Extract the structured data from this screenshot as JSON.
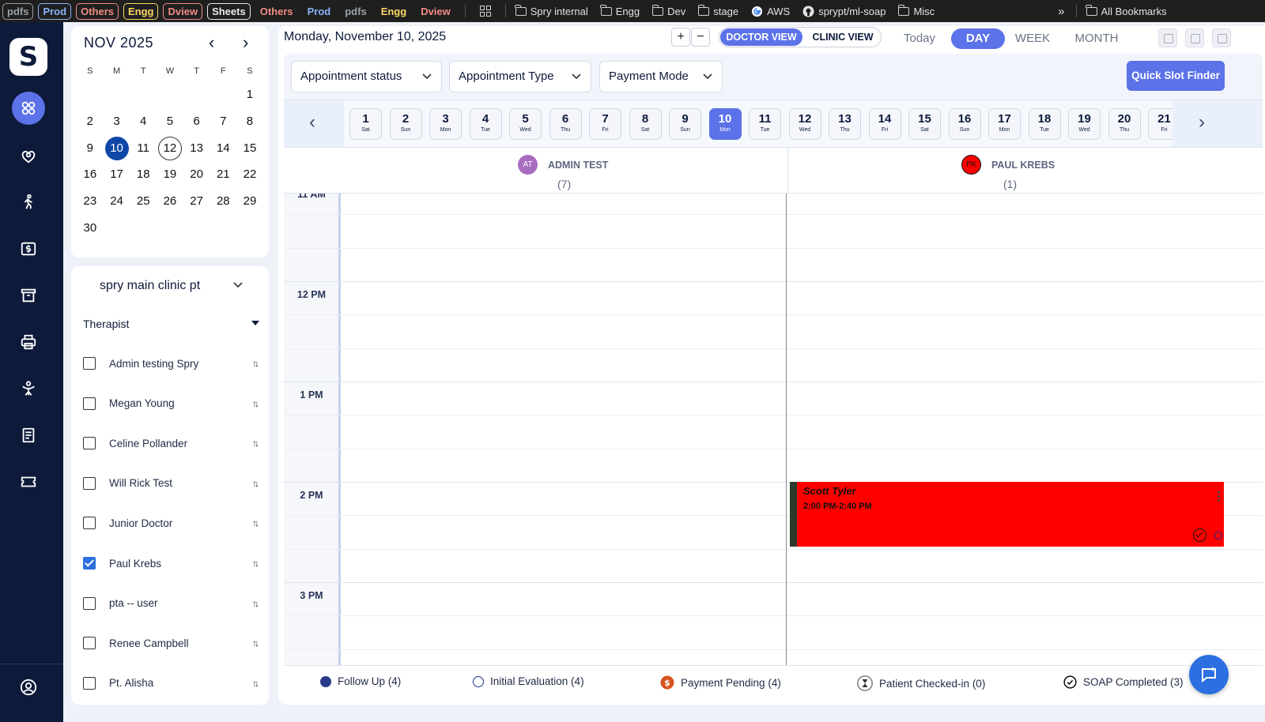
{
  "bookmarks": {
    "tags": [
      {
        "label": "pdfs",
        "color": "#9aa0a6",
        "plain": false
      },
      {
        "label": "Prod",
        "color": "#8ab4f8",
        "plain": false
      },
      {
        "label": "Others",
        "color": "#f28b82",
        "plain": false
      },
      {
        "label": "Engg",
        "color": "#fdd663",
        "plain": false
      },
      {
        "label": "Dview",
        "color": "#f28b82",
        "plain": false
      },
      {
        "label": "Sheets",
        "color": "#e8eaed",
        "plain": false
      },
      {
        "label": "Others",
        "color": "#f28b82",
        "plain": true
      },
      {
        "label": "Prod",
        "color": "#8ab4f8",
        "plain": true
      },
      {
        "label": "pdfs",
        "color": "#9aa0a6",
        "plain": true
      },
      {
        "label": "Engg",
        "color": "#fdd663",
        "plain": true
      },
      {
        "label": "Dview",
        "color": "#f28b82",
        "plain": true
      }
    ],
    "folders": [
      "Spry internal",
      "Engg",
      "Dev",
      "stage"
    ],
    "links": [
      "AWS",
      "sprypt/ml-soap"
    ],
    "misc": "Misc",
    "more": "»",
    "all_bookmarks": "All Bookmarks"
  },
  "rail": {
    "logo": "S",
    "items": [
      "dashboard-icon",
      "patients-icon",
      "exercise-icon",
      "billing-icon",
      "archive-icon",
      "print-icon",
      "therapy-icon",
      "notes-icon",
      "ticket-icon",
      "profile-icon"
    ]
  },
  "mini_calendar": {
    "title": "NOV 2025",
    "prev": "‹",
    "next": "›",
    "weekdays": [
      "S",
      "M",
      "T",
      "W",
      "T",
      "F",
      "S"
    ],
    "leading_blanks": 6,
    "days": [
      "1",
      "2",
      "3",
      "4",
      "5",
      "6",
      "7",
      "8",
      "9",
      "10",
      "11",
      "12",
      "13",
      "14",
      "15",
      "16",
      "17",
      "18",
      "19",
      "20",
      "21",
      "22",
      "23",
      "24",
      "25",
      "26",
      "27",
      "28",
      "29",
      "30"
    ],
    "selected": "10",
    "today": "12"
  },
  "filters": {
    "clinic": "spry main clinic pt",
    "therapist_label": "Therapist",
    "therapists": [
      {
        "name": "Admin testing Spry",
        "checked": false
      },
      {
        "name": "Megan Young",
        "checked": false
      },
      {
        "name": "Celine Pollander",
        "checked": false
      },
      {
        "name": "Will Rick Test",
        "checked": false
      },
      {
        "name": "Junior Doctor",
        "checked": false
      },
      {
        "name": "Paul Krebs",
        "checked": true
      },
      {
        "name": "pta -- user",
        "checked": false
      },
      {
        "name": "Renee Campbell",
        "checked": false
      },
      {
        "name": "Pt. Alisha",
        "checked": false
      }
    ]
  },
  "header": {
    "date": "Monday, November 10, 2025",
    "zoom_in": "+",
    "zoom_out": "−",
    "doctor_view": "DOCTOR VIEW",
    "clinic_view": "CLINIC VIEW",
    "today": "Today",
    "day": "DAY",
    "week": "WEEK",
    "month": "MONTH"
  },
  "toolbar": {
    "appointment_status": "Appointment status",
    "appointment_type": "Appointment Type",
    "payment_mode": "Payment Mode",
    "quick_slot": "Quick Slot Finder"
  },
  "day_strip": {
    "prev": "‹",
    "next": "›",
    "days": [
      {
        "n": "1",
        "w": "Sat"
      },
      {
        "n": "2",
        "w": "Sun"
      },
      {
        "n": "3",
        "w": "Mon"
      },
      {
        "n": "4",
        "w": "Tue"
      },
      {
        "n": "5",
        "w": "Wed"
      },
      {
        "n": "6",
        "w": "Thu"
      },
      {
        "n": "7",
        "w": "Fri"
      },
      {
        "n": "8",
        "w": "Sat"
      },
      {
        "n": "9",
        "w": "Sun"
      },
      {
        "n": "10",
        "w": "Mon"
      },
      {
        "n": "11",
        "w": "Tue"
      },
      {
        "n": "12",
        "w": "Wed"
      },
      {
        "n": "13",
        "w": "Thu"
      },
      {
        "n": "14",
        "w": "Fri"
      },
      {
        "n": "15",
        "w": "Sat"
      },
      {
        "n": "16",
        "w": "Sun"
      },
      {
        "n": "17",
        "w": "Mon"
      },
      {
        "n": "18",
        "w": "Tue"
      },
      {
        "n": "19",
        "w": "Wed"
      },
      {
        "n": "20",
        "w": "Thu"
      },
      {
        "n": "21",
        "w": "Fri"
      }
    ],
    "selected": "10"
  },
  "providers": [
    {
      "initials": "AT",
      "name": "ADMIN TEST",
      "count": "(7)",
      "avatar_bg": "#a86cc1",
      "avatar_fg": "#ffffff"
    },
    {
      "initials": "PK",
      "name": "PAUL KREBS",
      "count": "(1)",
      "avatar_bg": "#ff0000",
      "avatar_fg": "#111111"
    }
  ],
  "schedule": {
    "hours": [
      "11 AM",
      "12 PM",
      "1 PM",
      "2 PM",
      "3 PM"
    ],
    "appointment": {
      "patient": "Scott Tyler",
      "time": "2:00 PM-2:40 PM",
      "color": "#ff0000"
    }
  },
  "legend": [
    {
      "label": "Follow Up (4)",
      "icon": "filled-dot-icon",
      "color": "#2b3a8c"
    },
    {
      "label": "Initial Evaluation (4)",
      "icon": "ring-icon",
      "color": "#1c2f8c"
    },
    {
      "label": "Payment Pending (4)",
      "icon": "dollar-icon",
      "color": "#d9531e"
    },
    {
      "label": "Patient Checked-in (0)",
      "icon": "hourglass-icon",
      "color": "#333333"
    },
    {
      "label": "SOAP Completed (3)",
      "icon": "check-circle-icon",
      "color": "#111111"
    }
  ]
}
